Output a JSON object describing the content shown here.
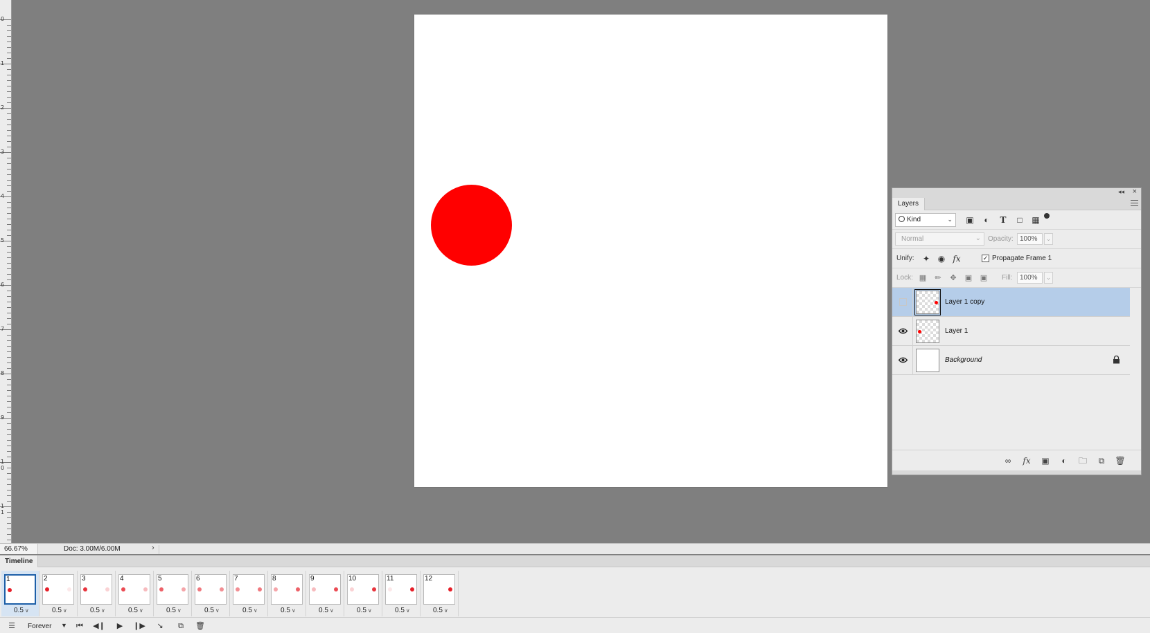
{
  "ruler": {
    "labels": [
      "0",
      "1",
      "2",
      "3",
      "4",
      "5",
      "6",
      "7",
      "8",
      "9",
      "10",
      "11"
    ]
  },
  "canvas": {
    "shape": "red-circle",
    "fill_color": "#ff0000",
    "background": "#ffffff"
  },
  "layers_panel": {
    "tab": "Layers",
    "filter": {
      "label": "Kind",
      "icons": [
        "image-filter-icon",
        "adjustment-filter-icon",
        "type-filter-icon",
        "shape-filter-icon",
        "smart-object-filter-icon"
      ]
    },
    "blend_mode": "Normal",
    "opacity_label": "Opacity:",
    "opacity_value": "100%",
    "unify_label": "Unify:",
    "propagate_label": "Propagate Frame 1",
    "propagate_checked": true,
    "lock_label": "Lock:",
    "fill_label": "Fill:",
    "fill_value": "100%",
    "layers": [
      {
        "name": "Layer 1 copy",
        "visible": false,
        "selected": true,
        "dot": "right"
      },
      {
        "name": "Layer 1",
        "visible": true,
        "selected": false,
        "dot": "left"
      },
      {
        "name": "Background",
        "visible": true,
        "selected": false,
        "locked": true
      }
    ]
  },
  "status": {
    "zoom": "66.67%",
    "doc": "Doc: 3.00M/6.00M"
  },
  "timeline": {
    "tab": "Timeline",
    "loop": "Forever",
    "frames": [
      {
        "num": "1",
        "delay": "0.5"
      },
      {
        "num": "2",
        "delay": "0.5"
      },
      {
        "num": "3",
        "delay": "0.5"
      },
      {
        "num": "4",
        "delay": "0.5"
      },
      {
        "num": "5",
        "delay": "0.5"
      },
      {
        "num": "6",
        "delay": "0.5"
      },
      {
        "num": "7",
        "delay": "0.5"
      },
      {
        "num": "8",
        "delay": "0.5"
      },
      {
        "num": "9",
        "delay": "0.5"
      },
      {
        "num": "10",
        "delay": "0.5"
      },
      {
        "num": "11",
        "delay": "0.5"
      },
      {
        "num": "12",
        "delay": "0.5"
      }
    ],
    "frame_dot_opacity": {
      "left": [
        1.0,
        1.0,
        0.9,
        0.8,
        0.7,
        0.6,
        0.5,
        0.4,
        0.3,
        0.2,
        0.1,
        0.0
      ],
      "right": [
        0.0,
        0.1,
        0.2,
        0.3,
        0.4,
        0.5,
        0.6,
        0.7,
        0.8,
        0.9,
        1.0,
        1.0
      ]
    }
  }
}
